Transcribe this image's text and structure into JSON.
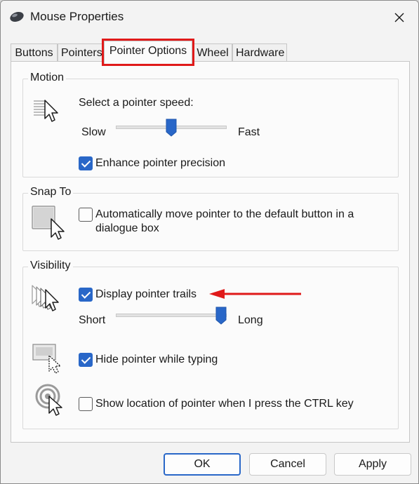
{
  "window": {
    "title": "Mouse Properties"
  },
  "tabs": [
    {
      "label": "Buttons"
    },
    {
      "label": "Pointers"
    },
    {
      "label": "Pointer Options"
    },
    {
      "label": "Wheel"
    },
    {
      "label": "Hardware"
    }
  ],
  "motion": {
    "group_label": "Motion",
    "speed_label": "Select a pointer speed:",
    "slow_label": "Slow",
    "fast_label": "Fast",
    "speed_fraction": 0.5,
    "enhance_precision": {
      "label": "Enhance pointer precision",
      "checked": true
    }
  },
  "snap_to": {
    "group_label": "Snap To",
    "auto_move": {
      "line1": "Automatically move pointer to the default button in a",
      "line2": "dialogue box",
      "checked": false
    }
  },
  "visibility": {
    "group_label": "Visibility",
    "trails": {
      "label": "Display pointer trails",
      "checked": true
    },
    "short_label": "Short",
    "long_label": "Long",
    "trail_length_fraction": 1.0,
    "hide_typing": {
      "label": "Hide pointer while typing",
      "checked": true
    },
    "show_location": {
      "label": "Show location of pointer when I press the CTRL key",
      "checked": false
    }
  },
  "buttons": {
    "ok": "OK",
    "cancel": "Cancel",
    "apply": "Apply"
  },
  "colors": {
    "accent": "#2967c8",
    "highlight": "#e01a1a",
    "annotation_arrow": "#e01a1a"
  },
  "icons": [
    "mouse-app-icon",
    "close-icon",
    "pointer-speed-icon",
    "snap-to-icon",
    "pointer-trails-icon",
    "hide-pointer-icon",
    "show-location-icon",
    "annotation-arrow-icon"
  ]
}
